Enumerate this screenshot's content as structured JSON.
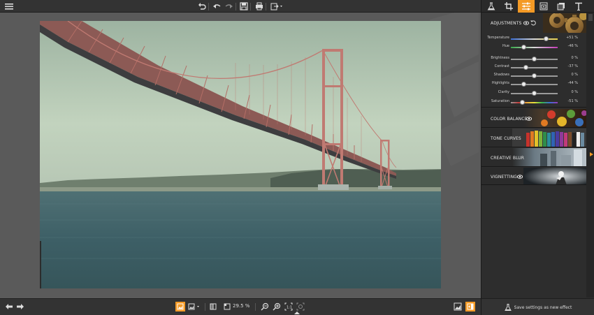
{
  "toolbar": {
    "menu_icon": "hamburger-icon",
    "icons": [
      "undo-icon",
      "undo-step-icon",
      "redo-step-icon",
      "save-icon",
      "print-icon",
      "export-icon"
    ]
  },
  "panel": {
    "tabs": [
      "flask-icon",
      "crop-icon",
      "sliders-icon",
      "layers-icon",
      "frames-icon",
      "text-icon"
    ],
    "active_tab": "sliders-icon",
    "adjustments": {
      "title": "ADJUSTMENTS",
      "sliders": [
        {
          "label": "Temperature",
          "value_text": "+51 %",
          "level": 0.755
        },
        {
          "label": "Hue",
          "value_text": "-46 %",
          "level": 0.27
        },
        {
          "label": "Brightness",
          "value_text": "0 %",
          "level": 0.5
        },
        {
          "label": "Contrast",
          "value_text": "-37 %",
          "level": 0.315
        },
        {
          "label": "Shadows",
          "value_text": "0 %",
          "level": 0.5
        },
        {
          "label": "Highlights",
          "value_text": "-44 %",
          "level": 0.28
        },
        {
          "label": "Clarity",
          "value_text": "0 %",
          "level": 0.5
        },
        {
          "label": "Saturation",
          "value_text": "-51 %",
          "level": 0.245
        }
      ]
    },
    "sections": [
      {
        "title": "COLOR BALANCE"
      },
      {
        "title": "TONE CURVES"
      },
      {
        "title": "CREATIVE BLUR"
      },
      {
        "title": "VIGNETTING"
      }
    ],
    "save_label": "Save settings as new effect"
  },
  "bottom": {
    "zoom": "29.5 %"
  },
  "colors": {
    "accent": "#f49a25",
    "panel_bg": "#2d2d2d",
    "canvas_bg": "#5a5a5a"
  }
}
